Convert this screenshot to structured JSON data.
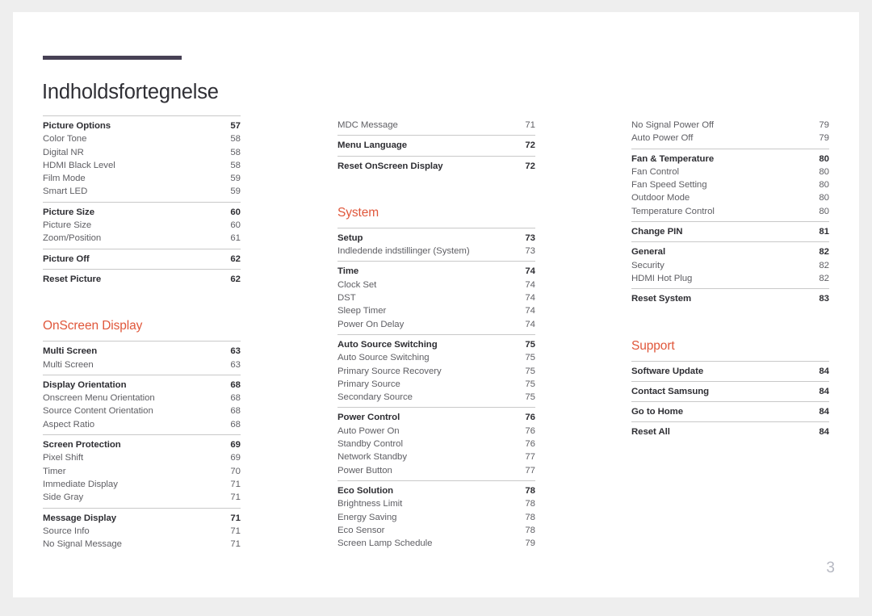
{
  "document": {
    "title": "Indholdsfortegnelse",
    "folio": "3",
    "accent_color": "#e0573b",
    "rule_color": "#474155",
    "line_color": "#c9c9c9"
  },
  "columns": [
    {
      "name": "column-1",
      "blocks": [
        {
          "type": "group",
          "rule": true,
          "rows": [
            {
              "label": "Picture Options",
              "page": "57",
              "level": 1
            },
            {
              "label": "Color Tone",
              "page": "58",
              "level": 2
            },
            {
              "label": "Digital NR",
              "page": "58",
              "level": 2
            },
            {
              "label": "HDMI Black Level",
              "page": "58",
              "level": 2
            },
            {
              "label": "Film Mode",
              "page": "59",
              "level": 2
            },
            {
              "label": "Smart LED",
              "page": "59",
              "level": 2
            }
          ]
        },
        {
          "type": "group",
          "rule": true,
          "rows": [
            {
              "label": "Picture Size",
              "page": "60",
              "level": 1
            },
            {
              "label": "Picture Size",
              "page": "60",
              "level": 2
            },
            {
              "label": "Zoom/Position",
              "page": "61",
              "level": 2
            }
          ]
        },
        {
          "type": "group",
          "rule": true,
          "rows": [
            {
              "label": "Picture Off",
              "page": "62",
              "level": 1
            }
          ]
        },
        {
          "type": "group",
          "rule": true,
          "rows": [
            {
              "label": "Reset Picture",
              "page": "62",
              "level": 1
            }
          ]
        },
        {
          "type": "gap",
          "size": "heading"
        },
        {
          "type": "heading",
          "label": "OnScreen Display"
        },
        {
          "type": "group",
          "rule": true,
          "rows": [
            {
              "label": "Multi Screen",
              "page": "63",
              "level": 1
            },
            {
              "label": "Multi Screen",
              "page": "63",
              "level": 2
            }
          ]
        },
        {
          "type": "group",
          "rule": true,
          "rows": [
            {
              "label": "Display Orientation",
              "page": "68",
              "level": 1
            },
            {
              "label": "Onscreen Menu Orientation",
              "page": "68",
              "level": 2
            },
            {
              "label": "Source Content Orientation",
              "page": "68",
              "level": 2
            },
            {
              "label": "Aspect Ratio",
              "page": "68",
              "level": 2
            }
          ]
        },
        {
          "type": "group",
          "rule": true,
          "rows": [
            {
              "label": "Screen Protection",
              "page": "69",
              "level": 1
            },
            {
              "label": "Pixel Shift",
              "page": "69",
              "level": 2
            },
            {
              "label": "Timer",
              "page": "70",
              "level": 2
            },
            {
              "label": "Immediate Display",
              "page": "71",
              "level": 2
            },
            {
              "label": "Side Gray",
              "page": "71",
              "level": 2
            }
          ]
        },
        {
          "type": "group",
          "rule": true,
          "rows": [
            {
              "label": "Message Display",
              "page": "71",
              "level": 1
            },
            {
              "label": "Source Info",
              "page": "71",
              "level": 2
            },
            {
              "label": "No Signal Message",
              "page": "71",
              "level": 2
            }
          ]
        }
      ]
    },
    {
      "name": "column-2",
      "blocks": [
        {
          "type": "group",
          "rule": false,
          "rows": [
            {
              "label": "MDC Message",
              "page": "71",
              "level": 2
            }
          ]
        },
        {
          "type": "group",
          "rule": true,
          "rows": [
            {
              "label": "Menu Language",
              "page": "72",
              "level": 1
            }
          ]
        },
        {
          "type": "group",
          "rule": true,
          "rows": [
            {
              "label": "Reset OnScreen Display",
              "page": "72",
              "level": 1
            }
          ]
        },
        {
          "type": "gap",
          "size": "heading"
        },
        {
          "type": "heading",
          "label": "System"
        },
        {
          "type": "group",
          "rule": true,
          "rows": [
            {
              "label": "Setup",
              "page": "73",
              "level": 1
            },
            {
              "label": "Indledende indstillinger (System)",
              "page": "73",
              "level": 2
            }
          ]
        },
        {
          "type": "group",
          "rule": true,
          "rows": [
            {
              "label": "Time",
              "page": "74",
              "level": 1
            },
            {
              "label": "Clock Set",
              "page": "74",
              "level": 2
            },
            {
              "label": "DST",
              "page": "74",
              "level": 2
            },
            {
              "label": "Sleep Timer",
              "page": "74",
              "level": 2
            },
            {
              "label": "Power On Delay",
              "page": "74",
              "level": 2
            }
          ]
        },
        {
          "type": "group",
          "rule": true,
          "rows": [
            {
              "label": "Auto Source Switching",
              "page": "75",
              "level": 1
            },
            {
              "label": "Auto Source Switching",
              "page": "75",
              "level": 2
            },
            {
              "label": "Primary Source Recovery",
              "page": "75",
              "level": 2
            },
            {
              "label": "Primary Source",
              "page": "75",
              "level": 2
            },
            {
              "label": "Secondary Source",
              "page": "75",
              "level": 2
            }
          ]
        },
        {
          "type": "group",
          "rule": true,
          "rows": [
            {
              "label": "Power Control",
              "page": "76",
              "level": 1
            },
            {
              "label": "Auto Power On",
              "page": "76",
              "level": 2
            },
            {
              "label": "Standby Control",
              "page": "76",
              "level": 2
            },
            {
              "label": "Network Standby",
              "page": "77",
              "level": 2
            },
            {
              "label": "Power Button",
              "page": "77",
              "level": 2
            }
          ]
        },
        {
          "type": "group",
          "rule": true,
          "rows": [
            {
              "label": "Eco Solution",
              "page": "78",
              "level": 1
            },
            {
              "label": "Brightness Limit",
              "page": "78",
              "level": 2
            },
            {
              "label": "Energy Saving",
              "page": "78",
              "level": 2
            },
            {
              "label": "Eco Sensor",
              "page": "78",
              "level": 2
            },
            {
              "label": "Screen Lamp Schedule",
              "page": "79",
              "level": 2
            }
          ]
        }
      ]
    },
    {
      "name": "column-3",
      "blocks": [
        {
          "type": "group",
          "rule": false,
          "rows": [
            {
              "label": "No Signal Power Off",
              "page": "79",
              "level": 2
            },
            {
              "label": "Auto Power Off",
              "page": "79",
              "level": 2
            }
          ]
        },
        {
          "type": "group",
          "rule": true,
          "rows": [
            {
              "label": "Fan & Temperature",
              "page": "80",
              "level": 1
            },
            {
              "label": "Fan Control",
              "page": "80",
              "level": 2
            },
            {
              "label": "Fan Speed Setting",
              "page": "80",
              "level": 2
            },
            {
              "label": "Outdoor Mode",
              "page": "80",
              "level": 2
            },
            {
              "label": "Temperature Control",
              "page": "80",
              "level": 2
            }
          ]
        },
        {
          "type": "group",
          "rule": true,
          "rows": [
            {
              "label": "Change PIN",
              "page": "81",
              "level": 1
            }
          ]
        },
        {
          "type": "group",
          "rule": true,
          "rows": [
            {
              "label": "General",
              "page": "82",
              "level": 1
            },
            {
              "label": "Security",
              "page": "82",
              "level": 2
            },
            {
              "label": "HDMI Hot Plug",
              "page": "82",
              "level": 2
            }
          ]
        },
        {
          "type": "group",
          "rule": true,
          "rows": [
            {
              "label": "Reset System",
              "page": "83",
              "level": 1
            }
          ]
        },
        {
          "type": "gap",
          "size": "heading"
        },
        {
          "type": "heading",
          "label": "Support"
        },
        {
          "type": "group",
          "rule": true,
          "rows": [
            {
              "label": "Software Update",
              "page": "84",
              "level": 1
            }
          ]
        },
        {
          "type": "group",
          "rule": true,
          "rows": [
            {
              "label": "Contact Samsung",
              "page": "84",
              "level": 1
            }
          ]
        },
        {
          "type": "group",
          "rule": true,
          "rows": [
            {
              "label": "Go to Home",
              "page": "84",
              "level": 1
            }
          ]
        },
        {
          "type": "group",
          "rule": true,
          "rows": [
            {
              "label": "Reset All",
              "page": "84",
              "level": 1
            }
          ]
        }
      ]
    }
  ]
}
